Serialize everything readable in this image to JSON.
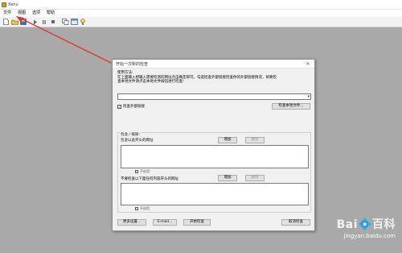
{
  "app": {
    "title": "Xenu"
  },
  "menubar": {
    "items": [
      "文件",
      "视图",
      "选项",
      "帮助"
    ]
  },
  "toolbar": {
    "icons": [
      "new-icon",
      "open-icon",
      "save-icon",
      "play-icon",
      "pause-icon",
      "stop-icon",
      "copy-icon",
      "window-icon",
      "help-icon"
    ]
  },
  "annotation": {
    "arrow_color": "#e03a2f"
  },
  "dialog": {
    "title": "开始一次新的检查",
    "close": "✕",
    "usage_heading": "使用方法:",
    "usage_text_1": "在上面输入想输入需要检测的网址点击确定即可。勾选检查外部链接检查你的外部链接情况，如要检",
    "usage_text_2": "查本地文件请点击本地文件按钮进行检查!",
    "url_value": "",
    "check_external_label": "检查外部链接",
    "check_external_checked": "✓",
    "local_file_button": "检查本地文件...",
    "group_label": "包含 / 排除:",
    "include_label": "包含以此开头的网址",
    "add_button_1": "增加",
    "delete_button_1": "删除",
    "not_enabled_1": "不启用",
    "exclude_label": "不要检查以下面任何内容开头的网址",
    "add_button_2": "增加",
    "delete_button_2": "删除",
    "not_enabled_2": "不启用",
    "more_settings_button": "更多设置...",
    "email_button": "E-mail...",
    "start_button": "开始检查",
    "cancel_button": "取消检查"
  },
  "watermark": {
    "logo": "Bai💠百科",
    "url": "jingyan.baidu.com"
  }
}
